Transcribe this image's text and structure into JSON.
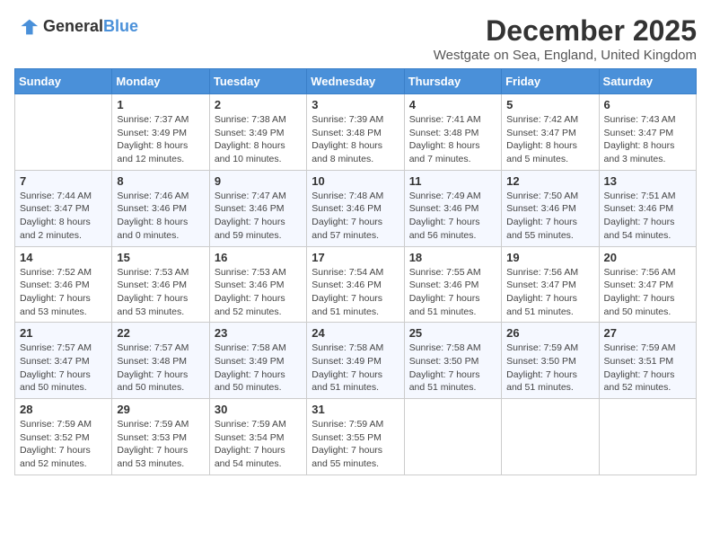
{
  "header": {
    "logo_general": "General",
    "logo_blue": "Blue",
    "month_title": "December 2025",
    "location": "Westgate on Sea, England, United Kingdom"
  },
  "weekdays": [
    "Sunday",
    "Monday",
    "Tuesday",
    "Wednesday",
    "Thursday",
    "Friday",
    "Saturday"
  ],
  "weeks": [
    [
      {
        "day": "",
        "sunrise": "",
        "sunset": "",
        "daylight": ""
      },
      {
        "day": "1",
        "sunrise": "Sunrise: 7:37 AM",
        "sunset": "Sunset: 3:49 PM",
        "daylight": "Daylight: 8 hours and 12 minutes."
      },
      {
        "day": "2",
        "sunrise": "Sunrise: 7:38 AM",
        "sunset": "Sunset: 3:49 PM",
        "daylight": "Daylight: 8 hours and 10 minutes."
      },
      {
        "day": "3",
        "sunrise": "Sunrise: 7:39 AM",
        "sunset": "Sunset: 3:48 PM",
        "daylight": "Daylight: 8 hours and 8 minutes."
      },
      {
        "day": "4",
        "sunrise": "Sunrise: 7:41 AM",
        "sunset": "Sunset: 3:48 PM",
        "daylight": "Daylight: 8 hours and 7 minutes."
      },
      {
        "day": "5",
        "sunrise": "Sunrise: 7:42 AM",
        "sunset": "Sunset: 3:47 PM",
        "daylight": "Daylight: 8 hours and 5 minutes."
      },
      {
        "day": "6",
        "sunrise": "Sunrise: 7:43 AM",
        "sunset": "Sunset: 3:47 PM",
        "daylight": "Daylight: 8 hours and 3 minutes."
      }
    ],
    [
      {
        "day": "7",
        "sunrise": "Sunrise: 7:44 AM",
        "sunset": "Sunset: 3:47 PM",
        "daylight": "Daylight: 8 hours and 2 minutes."
      },
      {
        "day": "8",
        "sunrise": "Sunrise: 7:46 AM",
        "sunset": "Sunset: 3:46 PM",
        "daylight": "Daylight: 8 hours and 0 minutes."
      },
      {
        "day": "9",
        "sunrise": "Sunrise: 7:47 AM",
        "sunset": "Sunset: 3:46 PM",
        "daylight": "Daylight: 7 hours and 59 minutes."
      },
      {
        "day": "10",
        "sunrise": "Sunrise: 7:48 AM",
        "sunset": "Sunset: 3:46 PM",
        "daylight": "Daylight: 7 hours and 57 minutes."
      },
      {
        "day": "11",
        "sunrise": "Sunrise: 7:49 AM",
        "sunset": "Sunset: 3:46 PM",
        "daylight": "Daylight: 7 hours and 56 minutes."
      },
      {
        "day": "12",
        "sunrise": "Sunrise: 7:50 AM",
        "sunset": "Sunset: 3:46 PM",
        "daylight": "Daylight: 7 hours and 55 minutes."
      },
      {
        "day": "13",
        "sunrise": "Sunrise: 7:51 AM",
        "sunset": "Sunset: 3:46 PM",
        "daylight": "Daylight: 7 hours and 54 minutes."
      }
    ],
    [
      {
        "day": "14",
        "sunrise": "Sunrise: 7:52 AM",
        "sunset": "Sunset: 3:46 PM",
        "daylight": "Daylight: 7 hours and 53 minutes."
      },
      {
        "day": "15",
        "sunrise": "Sunrise: 7:53 AM",
        "sunset": "Sunset: 3:46 PM",
        "daylight": "Daylight: 7 hours and 53 minutes."
      },
      {
        "day": "16",
        "sunrise": "Sunrise: 7:53 AM",
        "sunset": "Sunset: 3:46 PM",
        "daylight": "Daylight: 7 hours and 52 minutes."
      },
      {
        "day": "17",
        "sunrise": "Sunrise: 7:54 AM",
        "sunset": "Sunset: 3:46 PM",
        "daylight": "Daylight: 7 hours and 51 minutes."
      },
      {
        "day": "18",
        "sunrise": "Sunrise: 7:55 AM",
        "sunset": "Sunset: 3:46 PM",
        "daylight": "Daylight: 7 hours and 51 minutes."
      },
      {
        "day": "19",
        "sunrise": "Sunrise: 7:56 AM",
        "sunset": "Sunset: 3:47 PM",
        "daylight": "Daylight: 7 hours and 51 minutes."
      },
      {
        "day": "20",
        "sunrise": "Sunrise: 7:56 AM",
        "sunset": "Sunset: 3:47 PM",
        "daylight": "Daylight: 7 hours and 50 minutes."
      }
    ],
    [
      {
        "day": "21",
        "sunrise": "Sunrise: 7:57 AM",
        "sunset": "Sunset: 3:47 PM",
        "daylight": "Daylight: 7 hours and 50 minutes."
      },
      {
        "day": "22",
        "sunrise": "Sunrise: 7:57 AM",
        "sunset": "Sunset: 3:48 PM",
        "daylight": "Daylight: 7 hours and 50 minutes."
      },
      {
        "day": "23",
        "sunrise": "Sunrise: 7:58 AM",
        "sunset": "Sunset: 3:49 PM",
        "daylight": "Daylight: 7 hours and 50 minutes."
      },
      {
        "day": "24",
        "sunrise": "Sunrise: 7:58 AM",
        "sunset": "Sunset: 3:49 PM",
        "daylight": "Daylight: 7 hours and 51 minutes."
      },
      {
        "day": "25",
        "sunrise": "Sunrise: 7:58 AM",
        "sunset": "Sunset: 3:50 PM",
        "daylight": "Daylight: 7 hours and 51 minutes."
      },
      {
        "day": "26",
        "sunrise": "Sunrise: 7:59 AM",
        "sunset": "Sunset: 3:50 PM",
        "daylight": "Daylight: 7 hours and 51 minutes."
      },
      {
        "day": "27",
        "sunrise": "Sunrise: 7:59 AM",
        "sunset": "Sunset: 3:51 PM",
        "daylight": "Daylight: 7 hours and 52 minutes."
      }
    ],
    [
      {
        "day": "28",
        "sunrise": "Sunrise: 7:59 AM",
        "sunset": "Sunset: 3:52 PM",
        "daylight": "Daylight: 7 hours and 52 minutes."
      },
      {
        "day": "29",
        "sunrise": "Sunrise: 7:59 AM",
        "sunset": "Sunset: 3:53 PM",
        "daylight": "Daylight: 7 hours and 53 minutes."
      },
      {
        "day": "30",
        "sunrise": "Sunrise: 7:59 AM",
        "sunset": "Sunset: 3:54 PM",
        "daylight": "Daylight: 7 hours and 54 minutes."
      },
      {
        "day": "31",
        "sunrise": "Sunrise: 7:59 AM",
        "sunset": "Sunset: 3:55 PM",
        "daylight": "Daylight: 7 hours and 55 minutes."
      },
      {
        "day": "",
        "sunrise": "",
        "sunset": "",
        "daylight": ""
      },
      {
        "day": "",
        "sunrise": "",
        "sunset": "",
        "daylight": ""
      },
      {
        "day": "",
        "sunrise": "",
        "sunset": "",
        "daylight": ""
      }
    ]
  ]
}
